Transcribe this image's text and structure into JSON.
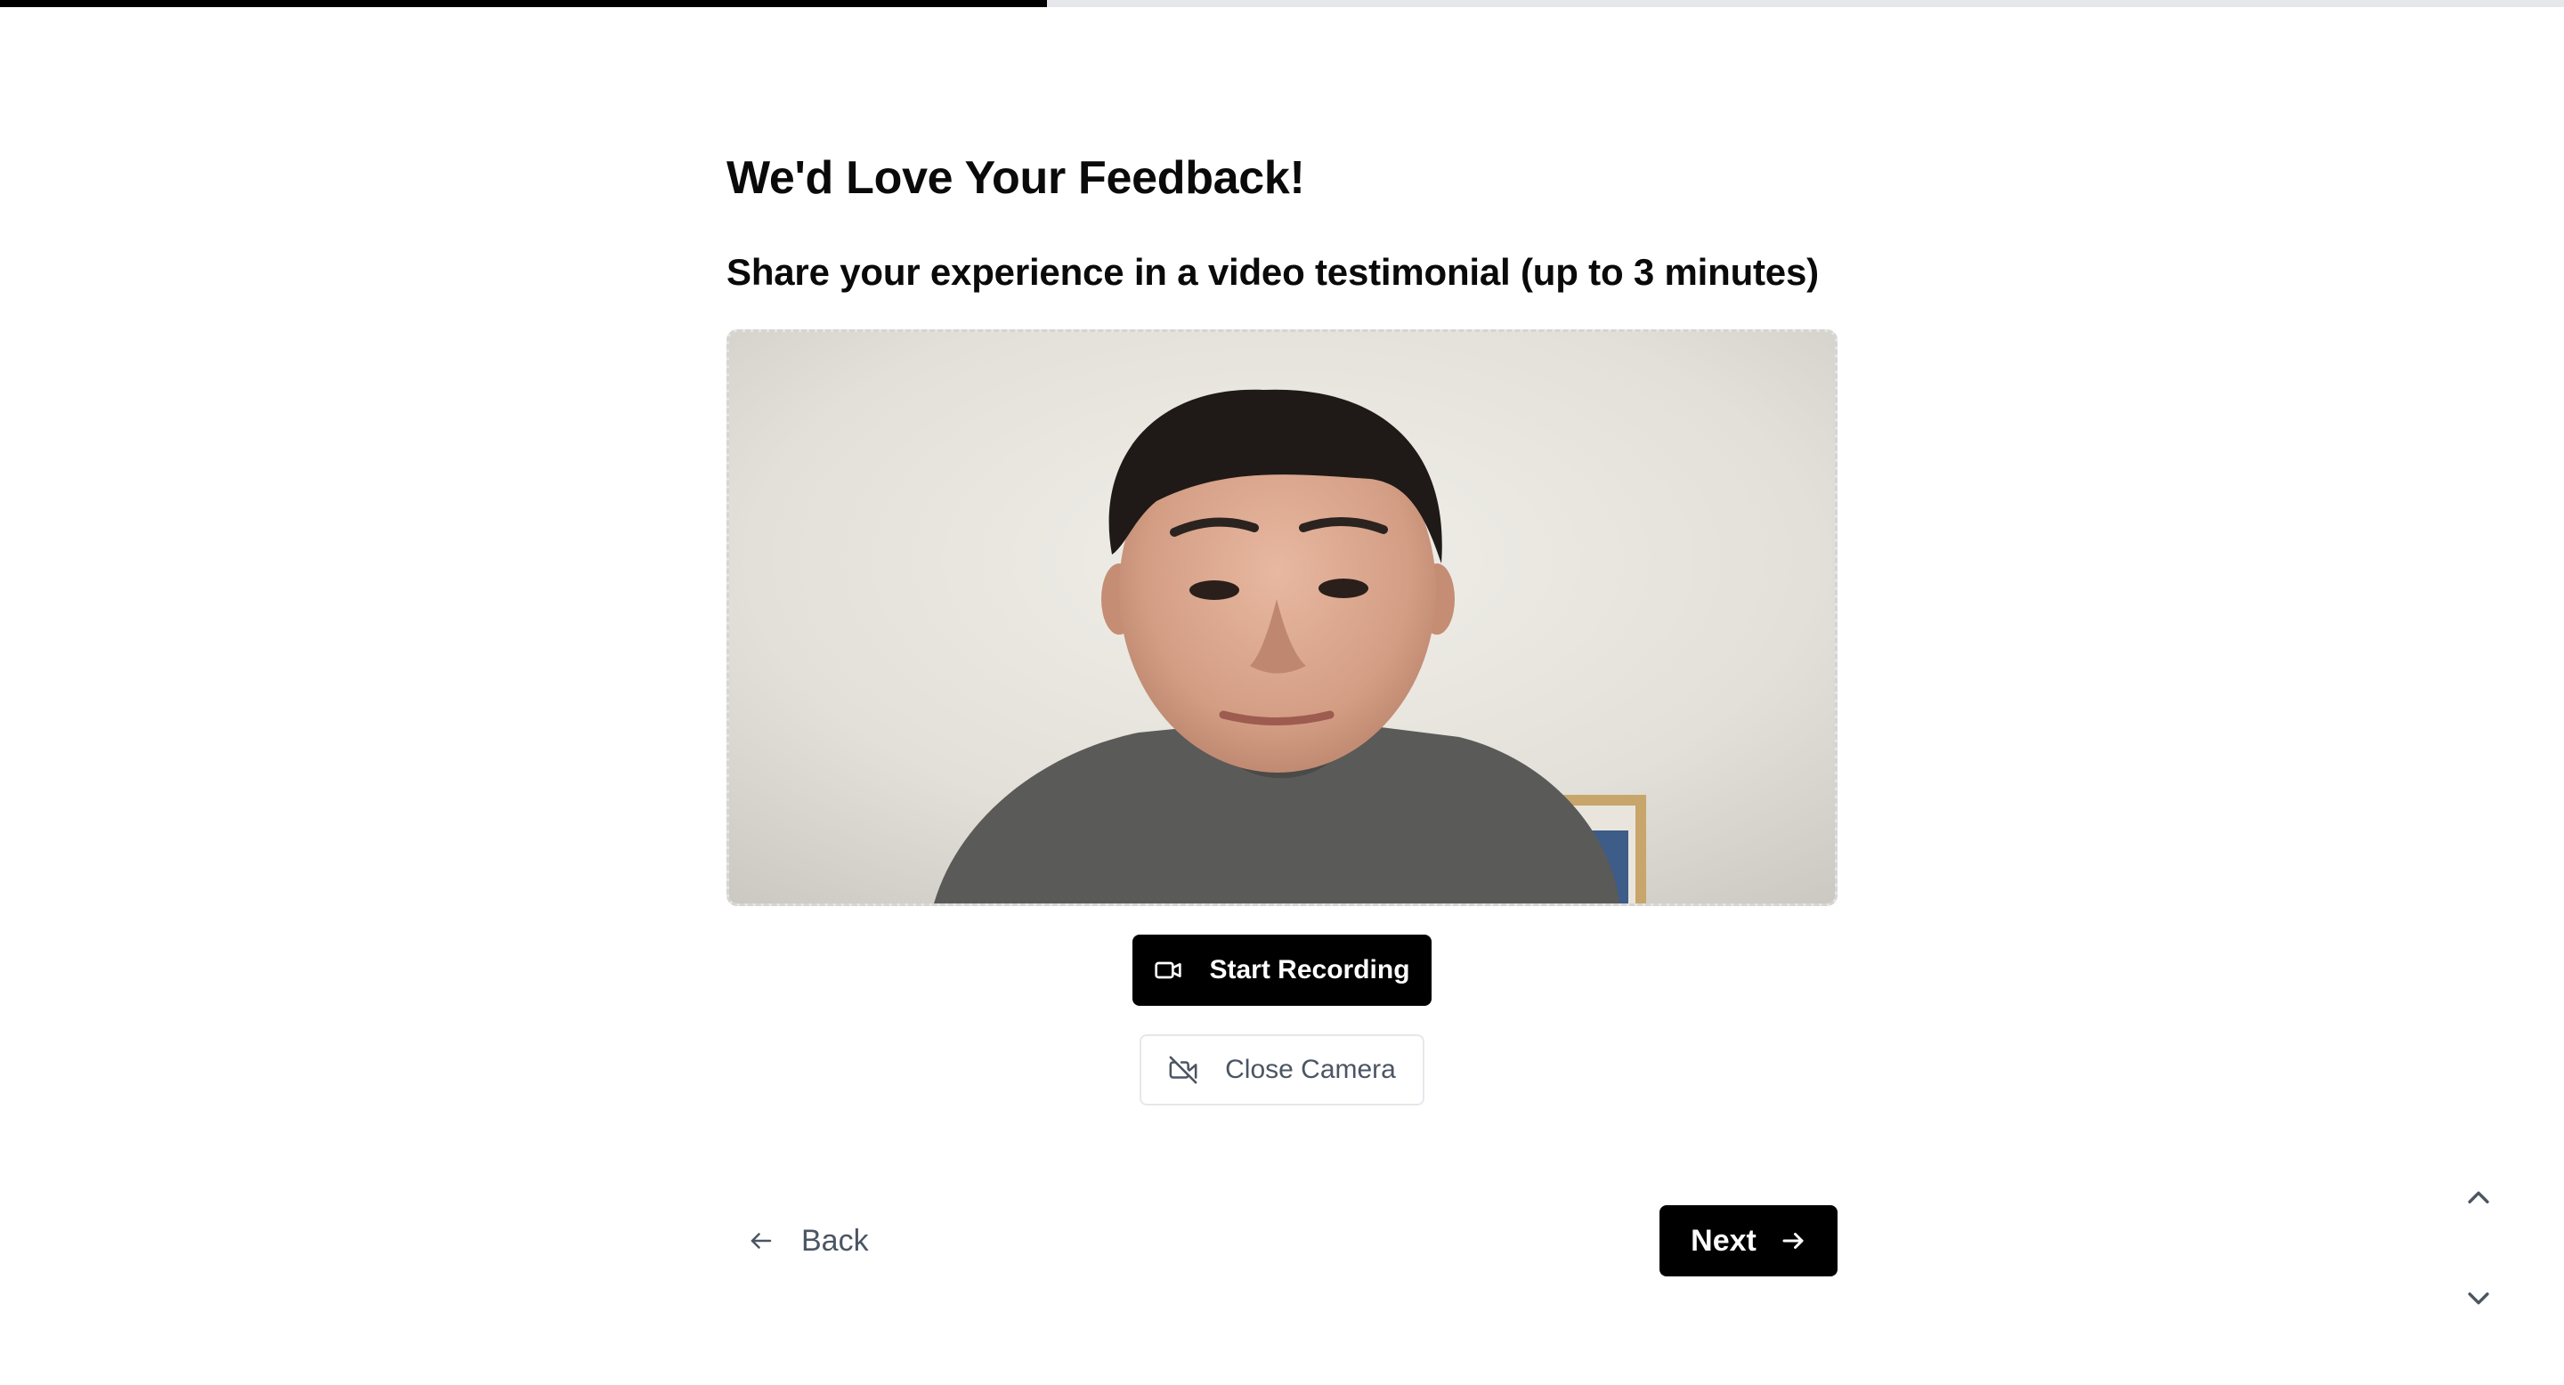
{
  "progress": {
    "fraction": 0.4083
  },
  "form": {
    "title": "We'd Love Your Feedback!",
    "subtitle": "Share your experience in a video testimonial (up to 3 minutes)"
  },
  "video": {
    "state": "camera-preview"
  },
  "actions": {
    "start_recording_label": "Start Recording",
    "start_recording_icon": "video-camera-icon",
    "close_camera_label": "Close Camera",
    "close_camera_icon": "video-off-icon"
  },
  "navigation": {
    "back_label": "Back",
    "back_icon": "arrow-left-icon",
    "next_label": "Next",
    "next_icon": "arrow-right-icon",
    "scroll_up_icon": "chevron-up-icon",
    "scroll_down_icon": "chevron-down-icon"
  },
  "colors": {
    "primary": "#000000",
    "muted_text": "#4b5563",
    "border": "#e5e7eb",
    "background": "#ffffff"
  }
}
